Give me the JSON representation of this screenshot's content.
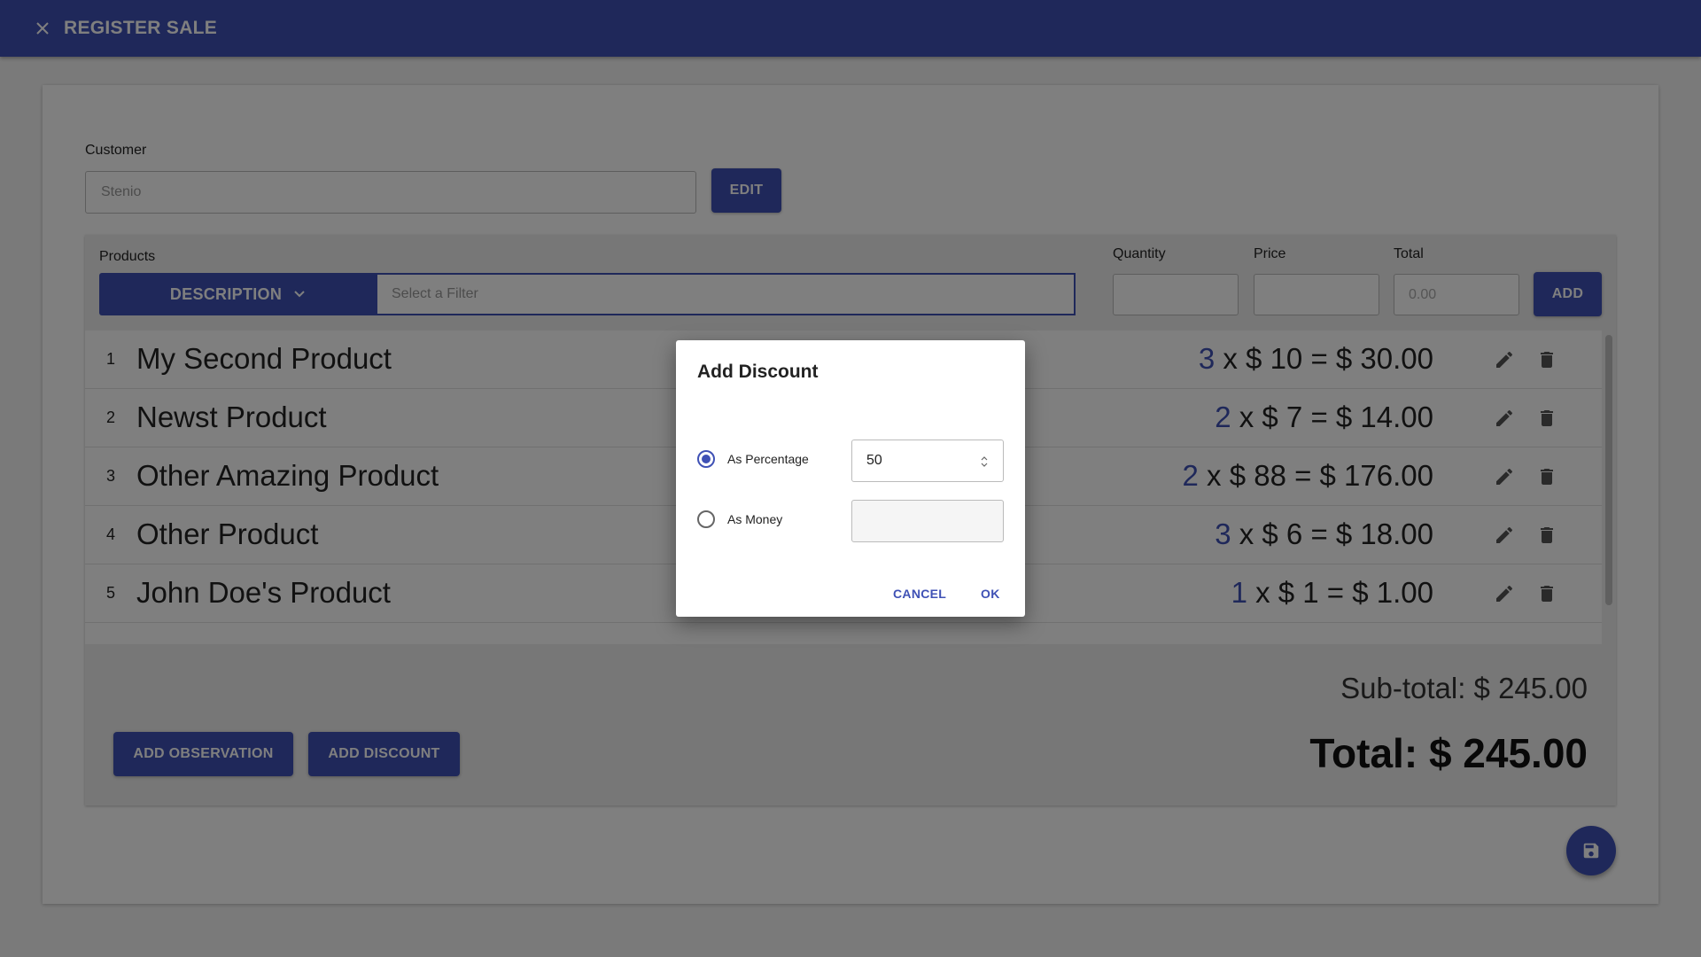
{
  "header": {
    "title": "REGISTER SALE",
    "close_icon": "close-icon"
  },
  "customer": {
    "label": "Customer",
    "value": "Stenio",
    "edit_label": "EDIT"
  },
  "products": {
    "label": "Products",
    "filter_type": "DESCRIPTION",
    "filter_placeholder": "Select a Filter",
    "quantity_label": "Quantity",
    "price_label": "Price",
    "total_label": "Total",
    "total_placeholder": "0.00",
    "add_label": "ADD"
  },
  "items": [
    {
      "num": "1",
      "name": "My Second Product",
      "qty": "3",
      "rest": " x $ 10 = $ 30.00"
    },
    {
      "num": "2",
      "name": "Newst Product",
      "qty": "2",
      "rest": " x $ 7 = $ 14.00"
    },
    {
      "num": "3",
      "name": "Other Amazing Product",
      "qty": "2",
      "rest": " x $ 88 = $ 176.00"
    },
    {
      "num": "4",
      "name": "Other Product",
      "qty": "3",
      "rest": " x $ 6 = $ 18.00"
    },
    {
      "num": "5",
      "name": "John Doe's Product",
      "qty": "1",
      "rest": " x $ 1 = $ 1.00"
    }
  ],
  "summary": {
    "subtotal": "Sub-total: $ 245.00",
    "total": "Total: $ 245.00",
    "add_observation": "ADD OBSERVATION",
    "add_discount": "ADD DISCOUNT"
  },
  "dialog": {
    "title": "Add Discount",
    "as_percentage": "As Percentage",
    "as_money": "As Money",
    "percentage_value": "50",
    "money_value": "",
    "cancel": "CANCEL",
    "ok": "OK",
    "selected": "percentage"
  },
  "colors": {
    "primary": "#3f51b5"
  }
}
